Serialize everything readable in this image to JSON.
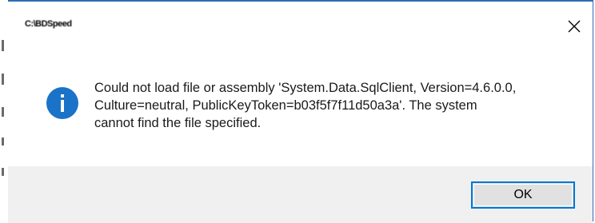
{
  "dialog": {
    "title": "C:\\BDSpeed",
    "close_icon": "close-icon",
    "message_icon": "info-icon",
    "message": "Could not load file or assembly 'System.Data.SqlClient, Version=4.6.0.0,\nCulture=neutral, PublicKeyToken=b03f5f7f11d50a3a'. The system\ncannot find the file specified.",
    "ok_label": "OK"
  },
  "colors": {
    "accent": "#0078d7",
    "border": "#2f6db5",
    "footer_bg": "#f0f0f0",
    "icon_blue": "#1a73c8"
  }
}
